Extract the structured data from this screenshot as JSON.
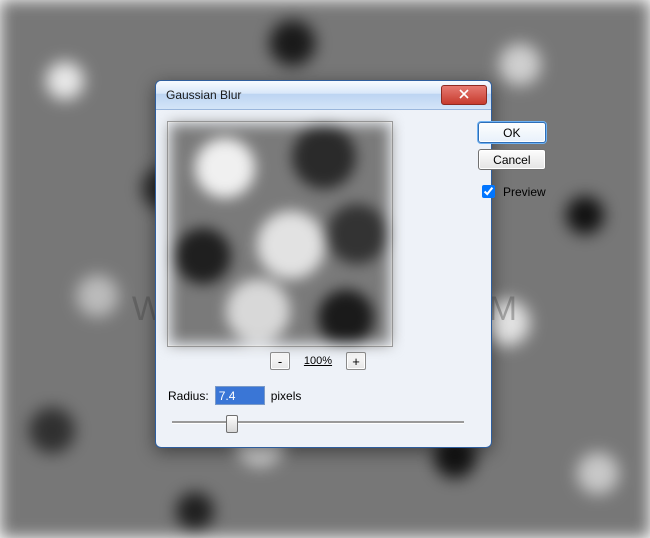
{
  "dialog": {
    "title": "Gaussian Blur",
    "buttons": {
      "ok": "OK",
      "cancel": "Cancel"
    },
    "preview_checkbox_label": "Preview",
    "preview_checked": true,
    "zoom": {
      "minus": "-",
      "plus": "+",
      "level": "100%"
    },
    "radius": {
      "label": "Radius:",
      "value": "7.4",
      "unit": "pixels"
    }
  },
  "watermark": "WWW.PSD-DUDE.COM"
}
